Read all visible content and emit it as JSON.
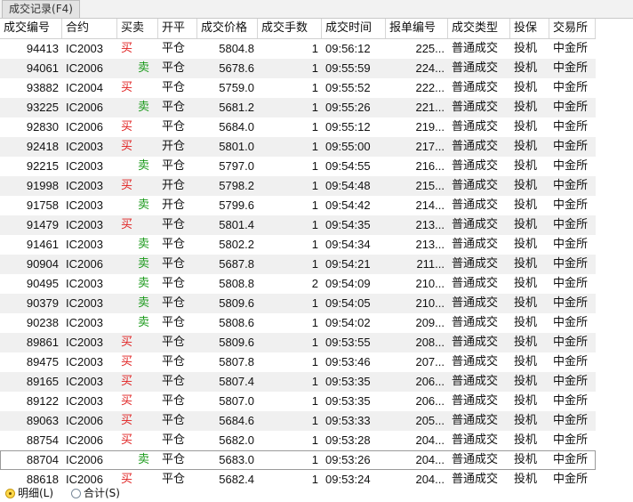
{
  "tab": {
    "label": "成交记录(F4)"
  },
  "columns": [
    "成交编号",
    "合约",
    "买卖",
    "开平",
    "成交价格",
    "成交手数",
    "成交时间",
    "报单编号",
    "成交类型",
    "投保",
    "交易所"
  ],
  "rows": [
    [
      "94413",
      "IC2003",
      "买",
      "平仓",
      "5804.8",
      "1",
      "09:56:12",
      "225...",
      "普通成交",
      "投机",
      "中金所"
    ],
    [
      "94061",
      "IC2006",
      "卖",
      "平仓",
      "5678.6",
      "1",
      "09:55:59",
      "224...",
      "普通成交",
      "投机",
      "中金所"
    ],
    [
      "93882",
      "IC2004",
      "买",
      "平仓",
      "5759.0",
      "1",
      "09:55:52",
      "222...",
      "普通成交",
      "投机",
      "中金所"
    ],
    [
      "93225",
      "IC2006",
      "卖",
      "平仓",
      "5681.2",
      "1",
      "09:55:26",
      "221...",
      "普通成交",
      "投机",
      "中金所"
    ],
    [
      "92830",
      "IC2006",
      "买",
      "平仓",
      "5684.0",
      "1",
      "09:55:12",
      "219...",
      "普通成交",
      "投机",
      "中金所"
    ],
    [
      "92418",
      "IC2003",
      "买",
      "开仓",
      "5801.0",
      "1",
      "09:55:00",
      "217...",
      "普通成交",
      "投机",
      "中金所"
    ],
    [
      "92215",
      "IC2003",
      "卖",
      "平仓",
      "5797.0",
      "1",
      "09:54:55",
      "216...",
      "普通成交",
      "投机",
      "中金所"
    ],
    [
      "91998",
      "IC2003",
      "买",
      "开仓",
      "5798.2",
      "1",
      "09:54:48",
      "215...",
      "普通成交",
      "投机",
      "中金所"
    ],
    [
      "91758",
      "IC2003",
      "卖",
      "开仓",
      "5799.6",
      "1",
      "09:54:42",
      "214...",
      "普通成交",
      "投机",
      "中金所"
    ],
    [
      "91479",
      "IC2003",
      "买",
      "平仓",
      "5801.4",
      "1",
      "09:54:35",
      "213...",
      "普通成交",
      "投机",
      "中金所"
    ],
    [
      "91461",
      "IC2003",
      "卖",
      "平仓",
      "5802.2",
      "1",
      "09:54:34",
      "213...",
      "普通成交",
      "投机",
      "中金所"
    ],
    [
      "90904",
      "IC2006",
      "卖",
      "平仓",
      "5687.8",
      "1",
      "09:54:21",
      "211...",
      "普通成交",
      "投机",
      "中金所"
    ],
    [
      "90495",
      "IC2003",
      "卖",
      "平仓",
      "5808.8",
      "2",
      "09:54:09",
      "210...",
      "普通成交",
      "投机",
      "中金所"
    ],
    [
      "90379",
      "IC2003",
      "卖",
      "平仓",
      "5809.6",
      "1",
      "09:54:05",
      "210...",
      "普通成交",
      "投机",
      "中金所"
    ],
    [
      "90238",
      "IC2003",
      "卖",
      "平仓",
      "5808.6",
      "1",
      "09:54:02",
      "209...",
      "普通成交",
      "投机",
      "中金所"
    ],
    [
      "89861",
      "IC2003",
      "买",
      "平仓",
      "5809.6",
      "1",
      "09:53:55",
      "208...",
      "普通成交",
      "投机",
      "中金所"
    ],
    [
      "89475",
      "IC2003",
      "买",
      "平仓",
      "5807.8",
      "1",
      "09:53:46",
      "207...",
      "普通成交",
      "投机",
      "中金所"
    ],
    [
      "89165",
      "IC2003",
      "买",
      "平仓",
      "5807.4",
      "1",
      "09:53:35",
      "206...",
      "普通成交",
      "投机",
      "中金所"
    ],
    [
      "89122",
      "IC2003",
      "买",
      "平仓",
      "5807.0",
      "1",
      "09:53:35",
      "206...",
      "普通成交",
      "投机",
      "中金所"
    ],
    [
      "89063",
      "IC2006",
      "买",
      "平仓",
      "5684.6",
      "1",
      "09:53:33",
      "205...",
      "普通成交",
      "投机",
      "中金所"
    ],
    [
      "88754",
      "IC2006",
      "买",
      "平仓",
      "5682.0",
      "1",
      "09:53:28",
      "204...",
      "普通成交",
      "投机",
      "中金所"
    ],
    [
      "88704",
      "IC2006",
      "卖",
      "平仓",
      "5683.0",
      "1",
      "09:53:26",
      "204...",
      "普通成交",
      "投机",
      "中金所"
    ],
    [
      "88618",
      "IC2006",
      "买",
      "平仓",
      "5682.4",
      "1",
      "09:53:24",
      "204...",
      "普通成交",
      "投机",
      "中金所"
    ]
  ],
  "selected_row": 21,
  "colors": {
    "buy": "#e02020",
    "sell": "#1a9a1a",
    "alt_row": "#f0f0f0"
  },
  "bottom": {
    "detail_label": "明细(L)",
    "summary_label": "合计(S)",
    "selected": "detail"
  }
}
